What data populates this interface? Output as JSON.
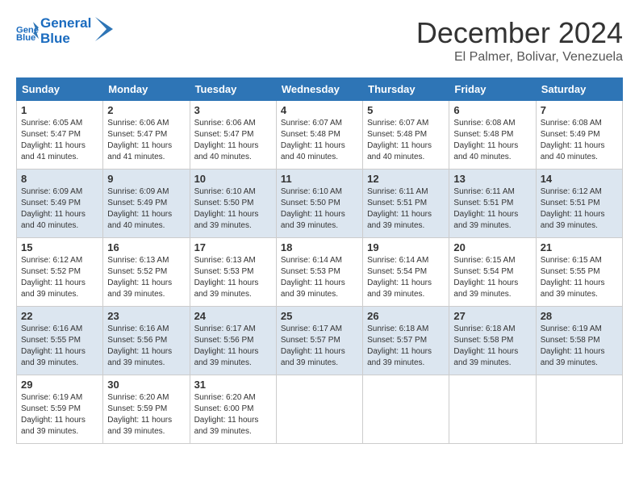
{
  "header": {
    "logo_line1": "General",
    "logo_line2": "Blue",
    "month_title": "December 2024",
    "subtitle": "El Palmer, Bolivar, Venezuela"
  },
  "weekdays": [
    "Sunday",
    "Monday",
    "Tuesday",
    "Wednesday",
    "Thursday",
    "Friday",
    "Saturday"
  ],
  "weeks": [
    [
      {
        "day": "1",
        "sunrise": "6:05 AM",
        "sunset": "5:47 PM",
        "daylight": "11 hours and 41 minutes."
      },
      {
        "day": "2",
        "sunrise": "6:06 AM",
        "sunset": "5:47 PM",
        "daylight": "11 hours and 41 minutes."
      },
      {
        "day": "3",
        "sunrise": "6:06 AM",
        "sunset": "5:47 PM",
        "daylight": "11 hours and 40 minutes."
      },
      {
        "day": "4",
        "sunrise": "6:07 AM",
        "sunset": "5:48 PM",
        "daylight": "11 hours and 40 minutes."
      },
      {
        "day": "5",
        "sunrise": "6:07 AM",
        "sunset": "5:48 PM",
        "daylight": "11 hours and 40 minutes."
      },
      {
        "day": "6",
        "sunrise": "6:08 AM",
        "sunset": "5:48 PM",
        "daylight": "11 hours and 40 minutes."
      },
      {
        "day": "7",
        "sunrise": "6:08 AM",
        "sunset": "5:49 PM",
        "daylight": "11 hours and 40 minutes."
      }
    ],
    [
      {
        "day": "8",
        "sunrise": "6:09 AM",
        "sunset": "5:49 PM",
        "daylight": "11 hours and 40 minutes."
      },
      {
        "day": "9",
        "sunrise": "6:09 AM",
        "sunset": "5:49 PM",
        "daylight": "11 hours and 40 minutes."
      },
      {
        "day": "10",
        "sunrise": "6:10 AM",
        "sunset": "5:50 PM",
        "daylight": "11 hours and 39 minutes."
      },
      {
        "day": "11",
        "sunrise": "6:10 AM",
        "sunset": "5:50 PM",
        "daylight": "11 hours and 39 minutes."
      },
      {
        "day": "12",
        "sunrise": "6:11 AM",
        "sunset": "5:51 PM",
        "daylight": "11 hours and 39 minutes."
      },
      {
        "day": "13",
        "sunrise": "6:11 AM",
        "sunset": "5:51 PM",
        "daylight": "11 hours and 39 minutes."
      },
      {
        "day": "14",
        "sunrise": "6:12 AM",
        "sunset": "5:51 PM",
        "daylight": "11 hours and 39 minutes."
      }
    ],
    [
      {
        "day": "15",
        "sunrise": "6:12 AM",
        "sunset": "5:52 PM",
        "daylight": "11 hours and 39 minutes."
      },
      {
        "day": "16",
        "sunrise": "6:13 AM",
        "sunset": "5:52 PM",
        "daylight": "11 hours and 39 minutes."
      },
      {
        "day": "17",
        "sunrise": "6:13 AM",
        "sunset": "5:53 PM",
        "daylight": "11 hours and 39 minutes."
      },
      {
        "day": "18",
        "sunrise": "6:14 AM",
        "sunset": "5:53 PM",
        "daylight": "11 hours and 39 minutes."
      },
      {
        "day": "19",
        "sunrise": "6:14 AM",
        "sunset": "5:54 PM",
        "daylight": "11 hours and 39 minutes."
      },
      {
        "day": "20",
        "sunrise": "6:15 AM",
        "sunset": "5:54 PM",
        "daylight": "11 hours and 39 minutes."
      },
      {
        "day": "21",
        "sunrise": "6:15 AM",
        "sunset": "5:55 PM",
        "daylight": "11 hours and 39 minutes."
      }
    ],
    [
      {
        "day": "22",
        "sunrise": "6:16 AM",
        "sunset": "5:55 PM",
        "daylight": "11 hours and 39 minutes."
      },
      {
        "day": "23",
        "sunrise": "6:16 AM",
        "sunset": "5:56 PM",
        "daylight": "11 hours and 39 minutes."
      },
      {
        "day": "24",
        "sunrise": "6:17 AM",
        "sunset": "5:56 PM",
        "daylight": "11 hours and 39 minutes."
      },
      {
        "day": "25",
        "sunrise": "6:17 AM",
        "sunset": "5:57 PM",
        "daylight": "11 hours and 39 minutes."
      },
      {
        "day": "26",
        "sunrise": "6:18 AM",
        "sunset": "5:57 PM",
        "daylight": "11 hours and 39 minutes."
      },
      {
        "day": "27",
        "sunrise": "6:18 AM",
        "sunset": "5:58 PM",
        "daylight": "11 hours and 39 minutes."
      },
      {
        "day": "28",
        "sunrise": "6:19 AM",
        "sunset": "5:58 PM",
        "daylight": "11 hours and 39 minutes."
      }
    ],
    [
      {
        "day": "29",
        "sunrise": "6:19 AM",
        "sunset": "5:59 PM",
        "daylight": "11 hours and 39 minutes."
      },
      {
        "day": "30",
        "sunrise": "6:20 AM",
        "sunset": "5:59 PM",
        "daylight": "11 hours and 39 minutes."
      },
      {
        "day": "31",
        "sunrise": "6:20 AM",
        "sunset": "6:00 PM",
        "daylight": "11 hours and 39 minutes."
      },
      null,
      null,
      null,
      null
    ]
  ],
  "labels": {
    "sunrise": "Sunrise:",
    "sunset": "Sunset:",
    "daylight": "Daylight hours"
  }
}
